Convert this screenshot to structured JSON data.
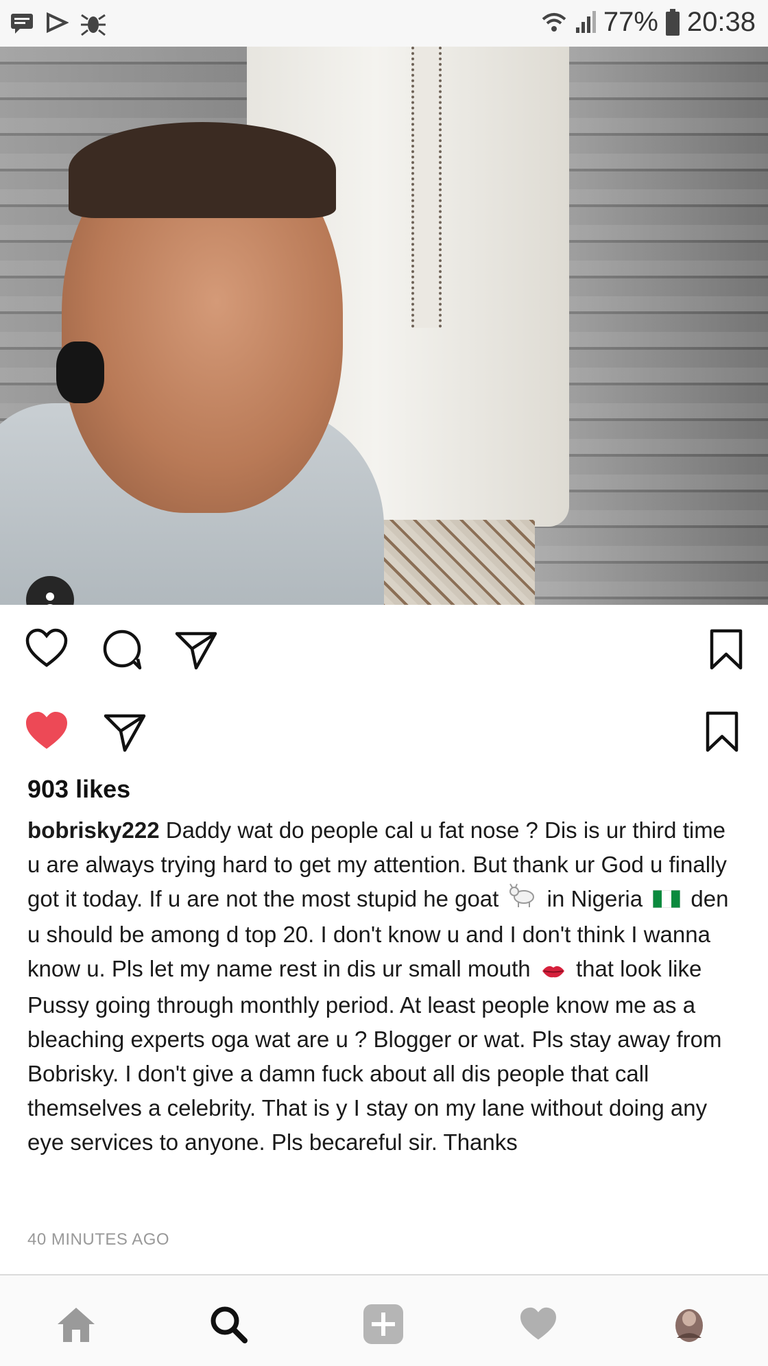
{
  "status_bar": {
    "battery": "77%",
    "time": "20:38",
    "icons": [
      "message-icon",
      "flag-icon",
      "bug-icon",
      "wifi-icon",
      "signal-icon",
      "battery-icon"
    ]
  },
  "post": {
    "likes": "903 likes",
    "username": "bobrisky222",
    "caption_parts": [
      "Daddy wat do people cal u fat nose ? Dis is ur third time u are always trying hard to get my attention. But thank ur God u finally got it today. If u are not the most stupid he goat",
      "in Nigeria",
      "den u should be among d top 20. I don't know u and I don't think I wanna know u. Pls let my name rest in dis ur small mouth",
      "that look like Pussy going through monthly period. At least people know me as a bleaching experts oga wat are u ? Blogger or wat. Pls stay away from Bobrisky. I don't give a damn fuck about all dis people that call themselves a celebrity. That is y I stay on my lane without doing any eye services to anyone. Pls becareful sir. Thanks"
    ],
    "timestamp": "40 MINUTES AGO",
    "heart_color": "#ed4956"
  },
  "nav": {
    "items": [
      "home-icon",
      "search-icon",
      "add-icon",
      "activity-icon",
      "profile-icon"
    ]
  }
}
